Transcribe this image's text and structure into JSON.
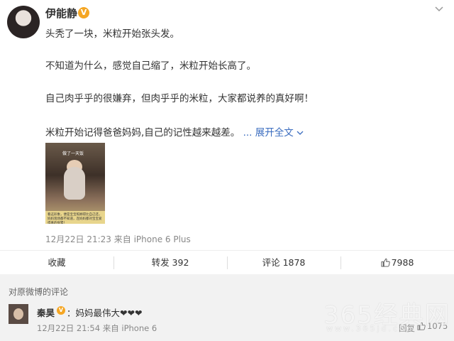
{
  "post": {
    "author": "伊能静",
    "verified_badge": "V",
    "lines": [
      "头秃了一块，米粒开始张头发。",
      "不知道为什么，感觉自己缩了，米粒开始长高了。",
      "自己肉乎乎的很嫌弃，但肉乎乎的米粒，大家都说养的真好啊！",
      "米粒开始记得爸爸妈妈,自己的记性越来越差。"
    ],
    "ellipsis": "...",
    "expand_label": "展开全文",
    "image": {
      "top_caption": "做了一天饭",
      "bottom_caption": "看这形象，便是宝宝照顾得比自己还，妈妈现场都不知道，连妈妈都对宝宝爱得真的很累！"
    },
    "meta": "12月22日 21:23 来自 iPhone 6 Plus",
    "more_icon": "chevron-down-icon"
  },
  "actions": {
    "favorite": "收藏",
    "repost": "转发 392",
    "comment": "评论 1878",
    "like": "7988"
  },
  "comments": {
    "section_title": "对原微博的评论",
    "items": [
      {
        "name": "秦昊",
        "verified_badge": "V",
        "text": "：妈妈最伟大❤❤❤",
        "meta": "12月22日 21:54 来自 iPhone 6",
        "reply": "回复",
        "likes": "1075"
      }
    ]
  },
  "watermark": {
    "text": "365经典网",
    "url": "www.365jd.com"
  },
  "colors": {
    "link": "#3a6cbf",
    "badge": "#f5a623",
    "comment_bg": "#f2f2f2"
  }
}
